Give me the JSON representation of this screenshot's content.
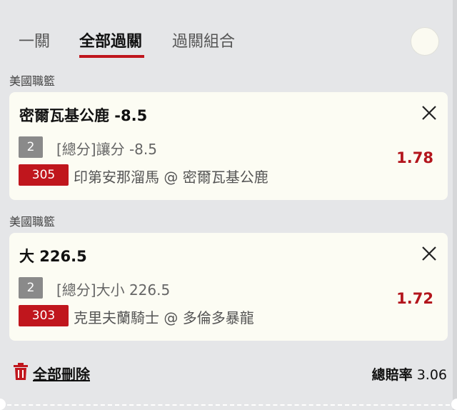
{
  "tabs": [
    {
      "label": "一關",
      "active": false
    },
    {
      "label": "全部過關",
      "active": true
    },
    {
      "label": "過關組合",
      "active": false
    }
  ],
  "accent_color": "#c0161d",
  "bets": [
    {
      "league": "美國職籃",
      "title": "密爾瓦基公鹿 -8.5",
      "num": "2",
      "bet_desc": "[總分]讓分 -8.5",
      "team_code": "305",
      "match": "印第安那溜馬 @ 密爾瓦基公鹿",
      "odds": "1.78"
    },
    {
      "league": "美國職籃",
      "title": "大 226.5",
      "num": "2",
      "bet_desc": "[總分]大小 226.5",
      "team_code": "303",
      "match": "克里夫蘭騎士 @ 多倫多暴龍",
      "odds": "1.72"
    }
  ],
  "footer": {
    "delete_all": "全部刪除",
    "total_label": "總賠率",
    "total_value": "3.06"
  }
}
